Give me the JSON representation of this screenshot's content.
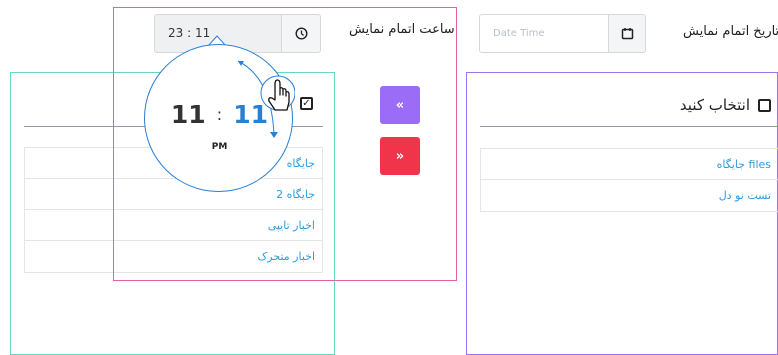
{
  "date_section": {
    "label": "تاریخ اتمام نمایش",
    "placeholder": "Date Time",
    "icon": "calendar-icon"
  },
  "time_section": {
    "label": "ساعت اتمام نمایش",
    "value": "23 : 11",
    "icon": "clock-icon"
  },
  "right_panel": {
    "header": "انتخاب کنید",
    "items": [
      "جایگاه files",
      "تست نو دل"
    ]
  },
  "left_panel": {
    "items": [
      "جایگاه",
      "جایگاه 2",
      "اخبار تایپی",
      "اخبار متحرک"
    ]
  },
  "transfer_buttons": {
    "move_left": "«",
    "move_right": "»",
    "colors": {
      "move_left": "#9b6cf5",
      "move_right": "#f0344a"
    }
  },
  "clock_popup": {
    "hours": "11",
    "separator": ":",
    "minutes": "11",
    "period": "PM",
    "accent": "#2b7fd0"
  }
}
